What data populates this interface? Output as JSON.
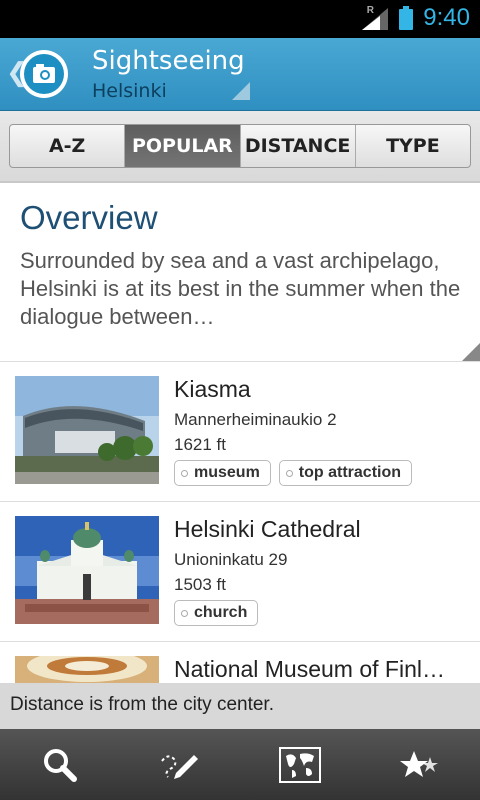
{
  "status_bar": {
    "time": "9:40",
    "roaming_label": "R"
  },
  "action_bar": {
    "title": "Sightseeing",
    "subtitle": "Helsinki",
    "app_icon": "camera-icon"
  },
  "tabs": [
    {
      "label": "A-Z",
      "active": false
    },
    {
      "label": "POPULAR",
      "active": true
    },
    {
      "label": "DISTANCE",
      "active": false
    },
    {
      "label": "TYPE",
      "active": false
    }
  ],
  "overview": {
    "heading": "Overview",
    "text": "Surrounded by sea and a vast archipelago, Helsinki is at its best in the summer when the dialogue between…"
  },
  "places": [
    {
      "name": "Kiasma",
      "address": "Mannerheiminaukio 2",
      "distance": "1621 ft",
      "tags": [
        "museum",
        "top attraction"
      ]
    },
    {
      "name": "Helsinki Cathedral",
      "address": "Unioninkatu 29",
      "distance": "1503 ft",
      "tags": [
        "church"
      ]
    },
    {
      "name": "National Museum of Finl…",
      "address": "",
      "distance": "",
      "tags": []
    }
  ],
  "toast": {
    "text": "Distance is from the city center."
  },
  "bottom_nav": [
    {
      "icon": "search-icon"
    },
    {
      "icon": "note-pen-icon"
    },
    {
      "icon": "world-map-icon"
    },
    {
      "icon": "favorite-stars-icon"
    }
  ],
  "colors": {
    "accent": "#33b5e5",
    "action_bar": "#3a9ccb",
    "heading": "#1e4f74"
  }
}
